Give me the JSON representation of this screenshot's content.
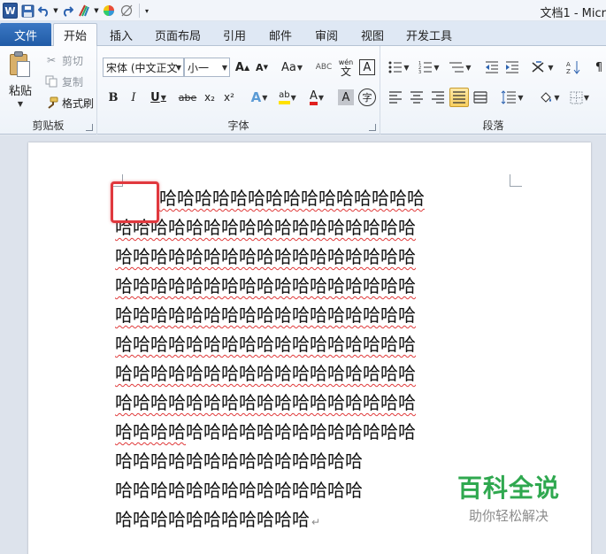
{
  "titlebar": {
    "title": "文档1 - Micr"
  },
  "tabs": {
    "file": "文件",
    "items": [
      "开始",
      "插入",
      "页面布局",
      "引用",
      "邮件",
      "审阅",
      "视图",
      "开发工具"
    ],
    "active": "开始"
  },
  "ribbon": {
    "clipboard": {
      "label": "剪贴板",
      "paste": "粘贴",
      "cut": "剪切",
      "copy": "复制",
      "format_painter": "格式刷"
    },
    "font": {
      "label": "字体",
      "font_name": "宋体 (中文正文",
      "font_size": "小一",
      "grow": "A",
      "shrink": "A",
      "change_case": "Aa",
      "clear_format": "ABC",
      "phonetic": "wén",
      "border_char": "A",
      "bold": "B",
      "italic": "I",
      "underline": "U",
      "strike": "abe",
      "subscript": "x₂",
      "superscript": "x²",
      "text_effect": "A",
      "highlight": "ab",
      "font_color": "A",
      "shading": "A",
      "enclose": "字"
    },
    "paragraph": {
      "label": "段落"
    }
  },
  "document": {
    "lines": [
      "哈哈哈哈哈哈哈哈哈哈哈哈哈哈哈",
      "哈哈哈哈哈哈哈哈哈哈哈哈哈哈哈哈哈",
      "哈哈哈哈哈哈哈哈哈哈哈哈哈哈哈哈哈",
      "哈哈哈哈哈哈哈哈哈哈哈哈哈哈哈哈哈",
      "哈哈哈哈哈哈哈哈哈哈哈哈哈哈哈哈哈",
      "哈哈哈哈哈哈哈哈哈哈哈哈哈哈哈哈哈",
      "哈哈哈哈哈哈哈哈哈哈哈哈哈哈哈哈哈",
      "哈哈哈哈哈哈哈哈哈哈哈哈哈哈哈哈哈",
      "哈哈哈哈哈哈哈哈哈哈哈哈哈哈哈哈哈",
      "哈哈哈哈哈哈哈哈哈哈哈哈哈哈",
      "哈哈哈哈哈哈哈哈哈哈哈哈哈哈",
      "哈哈哈哈哈哈哈哈哈哈哈"
    ],
    "line9_underlined_prefix": "哈哈哈哈",
    "line9_rest": "哈哈哈哈哈哈哈哈哈哈哈哈哈",
    "paragraph_mark": "↵"
  },
  "watermark": {
    "title": "百科全说",
    "subtitle": "助你轻松解决"
  },
  "colors": {
    "file_tab": "#215ba6",
    "highlight_box": "#e0383e",
    "spell_underline": "#e03a3a",
    "watermark_green": "#2fa84f"
  }
}
